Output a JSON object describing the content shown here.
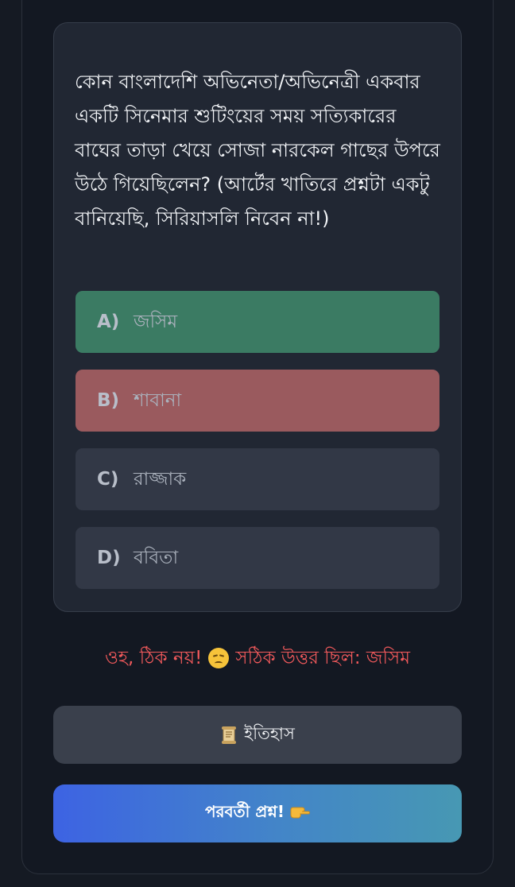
{
  "question": {
    "text": "কোন বাংলাদেশি অভিনেতা/অভিনেত্রী একবার একটি সিনেমার শুটিংয়ের সময় সত্যিকারের বাঘের তাড়া খেয়ে সোজা নারকেল গাছের উপরে উঠে গিয়েছিলেন? (আর্টের খাতিরে প্রশ্নটা একটু বানিয়েছি, সিরিয়াসলি নিবেন না!)"
  },
  "options": [
    {
      "letter": "A)",
      "label": "জসিম",
      "state": "correct",
      "color": "#3b7b63"
    },
    {
      "letter": "B)",
      "label": "শাবানা",
      "state": "wrong-selected",
      "color": "#9a5a5e"
    },
    {
      "letter": "C)",
      "label": "রাজ্জাক",
      "state": "neutral",
      "color": "#323846"
    },
    {
      "letter": "D)",
      "label": "ববিতা",
      "state": "neutral",
      "color": "#323846"
    }
  ],
  "feedback": {
    "prefix": "ওহ, ঠিক নয়!",
    "icon": "disappointed-face-icon",
    "suffix": "সঠিক উত্তর ছিল: জসিম",
    "color": "#f0595b"
  },
  "buttons": {
    "history_label": "ইতিহাস",
    "history_icon": "scroll-icon",
    "next_label": "পরবর্তী প্রশ্ন!",
    "next_icon": "pointing-hand-icon"
  },
  "colors": {
    "background": "#151a23",
    "card": "#212733",
    "accent_gradient_start": "#3d63e3",
    "accent_gradient_end": "#4798b3"
  }
}
